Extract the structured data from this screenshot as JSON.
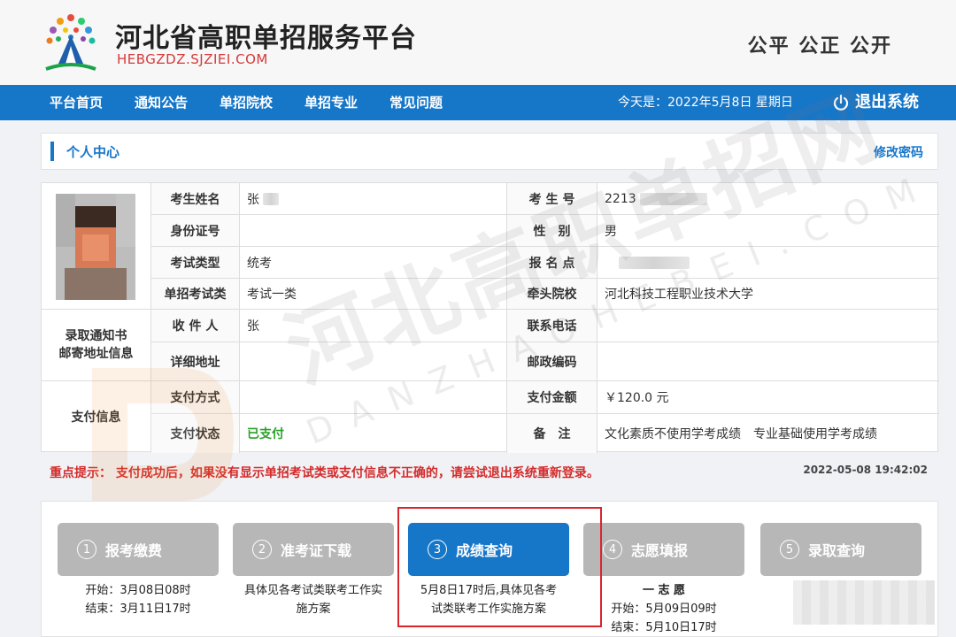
{
  "header": {
    "title": "河北省高职单招服务平台",
    "url": "HEBGZDZ.SJZIEI.COM",
    "slogan": "公平  公正  公开"
  },
  "nav": {
    "items": [
      "平台首页",
      "通知公告",
      "单招院校",
      "单招专业",
      "常见问题"
    ],
    "date": "今天是：2022年5月8日 星期日",
    "logout": "退出系统"
  },
  "panel": {
    "title": "个人中心",
    "change_password": "修改密码"
  },
  "info": {
    "side": {
      "mail": "录取通知书\n邮寄地址信息",
      "pay": "支付信息"
    },
    "rows": [
      {
        "l1": "考生姓名",
        "v1": "张",
        "l2": "考 生 号",
        "v2": "2213"
      },
      {
        "l1": "身份证号",
        "v1": "",
        "l2": "性　别",
        "v2": "男"
      },
      {
        "l1": "考试类型",
        "v1": "统考",
        "l2": "报 名 点",
        "v2": ""
      },
      {
        "l1": "单招考试类",
        "v1": "考试一类",
        "l2": "牵头院校",
        "v2": "河北科技工程职业技术大学"
      },
      {
        "l1": "收 件 人",
        "v1": "张",
        "l2": "联系电话",
        "v2": ""
      },
      {
        "l1": "详细地址",
        "v1": "",
        "l2": "邮政编码",
        "v2": ""
      },
      {
        "l1": "支付方式",
        "v1": "",
        "l2": "支付金额",
        "v2": "￥120.0 元"
      },
      {
        "l1": "支付状态",
        "v1": "已支付",
        "l2": "备　注",
        "v2": "文化素质不使用学考成绩　专业基础使用学考成绩"
      }
    ]
  },
  "warning": "重点提示：  支付成功后，如果没有显示单招考试类或支付信息不正确的，请尝试退出系统重新登录。",
  "timestamp": "2022-05-08 19:42:02",
  "steps": [
    {
      "num": "1",
      "label": "报考缴费",
      "desc": [
        "开始：3月08日08时",
        "结束：3月11日17时"
      ]
    },
    {
      "num": "2",
      "label": "准考证下载",
      "desc": [
        "具体见各考试类联考工作实",
        "施方案"
      ]
    },
    {
      "num": "3",
      "label": "成绩查询",
      "desc": [
        "5月8日17时后,具体见各考",
        "试类联考工作实施方案"
      ]
    },
    {
      "num": "4",
      "label": "志愿填报",
      "desc": [
        "一 志 愿",
        "开始：5月09日09时",
        "结束：5月10日17时"
      ]
    },
    {
      "num": "5",
      "label": "录取查询",
      "desc": []
    }
  ],
  "watermark": {
    "main": "河北高职单招网",
    "sub": "DANZHAOHEBEI.COM"
  },
  "colors": {
    "primary": "#1676c8",
    "warning": "#d42b2b",
    "paid": "#2aa32a",
    "inactive_step": "#b7b7b7"
  }
}
